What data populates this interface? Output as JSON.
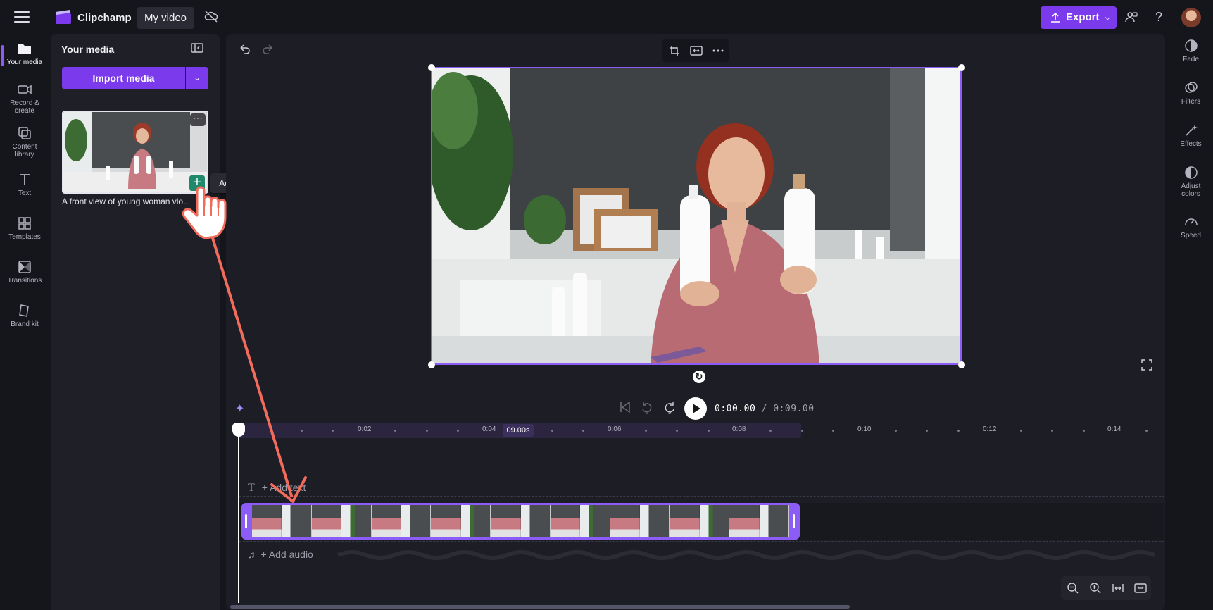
{
  "app": {
    "name": "Clipchamp",
    "project_name": "My video",
    "export_label": "Export"
  },
  "leftnav": [
    {
      "label": "Your media",
      "icon": "folder-icon"
    },
    {
      "label": "Record & create",
      "icon": "camera-icon"
    },
    {
      "label": "Content library",
      "icon": "library-icon"
    },
    {
      "label": "Text",
      "icon": "text-icon"
    },
    {
      "label": "Templates",
      "icon": "templates-icon"
    },
    {
      "label": "Transitions",
      "icon": "transitions-icon"
    },
    {
      "label": "Brand kit",
      "icon": "brand-kit-icon"
    }
  ],
  "media_panel": {
    "title": "Your media",
    "import_label": "Import media",
    "item_caption": "A front view of young woman vlo...",
    "tooltip": "Add to timeline"
  },
  "playback": {
    "current": "0:00.00",
    "separator": " / ",
    "total": "0:09.00"
  },
  "ruler": {
    "labels": [
      "0:02",
      "0:04",
      "0:06",
      "0:08",
      "0:10",
      "0:12",
      "0:14"
    ],
    "duration_badge": "09.00s"
  },
  "tracks": {
    "text_placeholder": "+ Add text",
    "audio_placeholder": "+ Add audio"
  },
  "rightnav": [
    {
      "label": "Fade",
      "icon": "fade-icon"
    },
    {
      "label": "Filters",
      "icon": "filters-icon"
    },
    {
      "label": "Effects",
      "icon": "effects-icon"
    },
    {
      "label": "Adjust colors",
      "icon": "adjust-colors-icon"
    },
    {
      "label": "Speed",
      "icon": "speed-icon"
    }
  ],
  "colors": {
    "accent": "#7c3aed",
    "selection": "#8b5cf6",
    "add_button": "#1f8a6b",
    "annotation_arrow": "#f26b5b"
  }
}
